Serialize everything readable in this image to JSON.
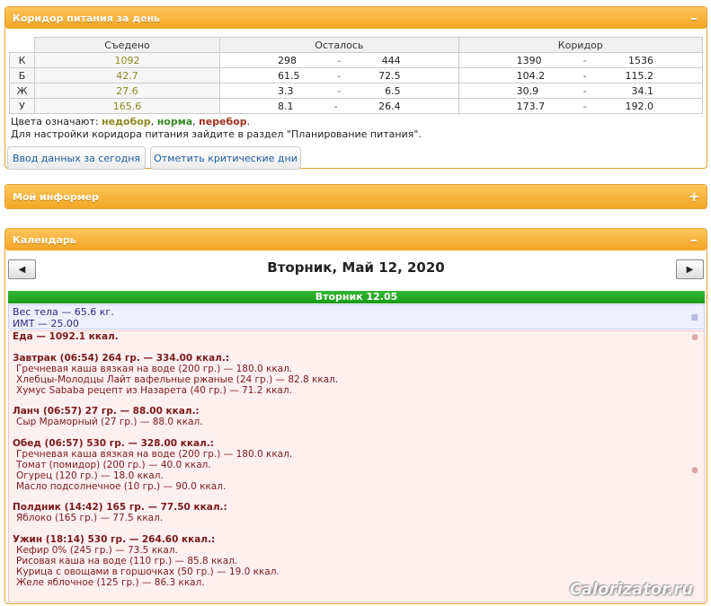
{
  "corridor_panel": {
    "title": "Коридор питания за день",
    "toggle": "–",
    "columns": {
      "eaten": "Съедено",
      "left": "Осталось",
      "corridor": "Коридор"
    },
    "rows": [
      {
        "label": "К",
        "eaten": "1092",
        "left_min": "298",
        "left_max": "444",
        "corr_min": "1390",
        "corr_max": "1536"
      },
      {
        "label": "Б",
        "eaten": "42.7",
        "left_min": "61.5",
        "left_max": "72.5",
        "corr_min": "104.2",
        "corr_max": "115.2"
      },
      {
        "label": "Ж",
        "eaten": "27.6",
        "left_min": "3.3",
        "left_max": "6.5",
        "corr_min": "30.9",
        "corr_max": "34.1"
      },
      {
        "label": "У",
        "eaten": "165.6",
        "left_min": "8.1",
        "left_max": "26.4",
        "corr_min": "173.7",
        "corr_max": "192.0"
      }
    ],
    "dash": "-",
    "legend_prefix": "Цвета означают: ",
    "legend_under": "недобор",
    "legend_norm": "норма",
    "legend_over": "перебор",
    "legend_sep": ", ",
    "legend_end": ".",
    "settings_note": "Для настройки коридора питания зайдите в раздел \"Планирование питания\".",
    "btn_enter": "Ввод данных за сегодня",
    "btn_critical": "Отметить критические дни",
    "colors": {
      "under": "#8a8a20",
      "norm": "#3a8a2a",
      "over": "#a03020"
    }
  },
  "informer_panel": {
    "title": "Мой информер",
    "toggle": "+"
  },
  "calendar_panel": {
    "title": "Календарь",
    "toggle": "–",
    "prev": "◀",
    "next": "▶",
    "date_title": "Вторник, Май 12, 2020",
    "day_header": "Вторник 12.05",
    "weight_line": "Вес тела — 65.6 кг.",
    "bmi_line": "ИМТ — 25.00",
    "food_lines": [
      {
        "text": "Еда — 1092.1 ккал.",
        "kind": "meal"
      },
      {
        "text": "",
        "kind": "gap"
      },
      {
        "text": "Завтрак (06:54) 264 гр. — 334.00 ккал.:",
        "kind": "meal"
      },
      {
        "text": "Гречневая каша вязкая на воде (200 гр.) — 180.0 ккал.",
        "kind": "item"
      },
      {
        "text": "Хлебцы-Молодцы Лайт вафельные ржаные (24 гр.) — 82.8 ккал.",
        "kind": "item"
      },
      {
        "text": "Хумус Sababa рецепт из Назарета (40 гр.) — 71.2 ккал.",
        "kind": "item"
      },
      {
        "text": "",
        "kind": "gap"
      },
      {
        "text": "Ланч (06:57) 27 гр. — 88.00 ккал.:",
        "kind": "meal"
      },
      {
        "text": "Сыр Мраморный (27 гр.) — 88.0 ккал.",
        "kind": "item"
      },
      {
        "text": "",
        "kind": "gap"
      },
      {
        "text": "Обед (06:57) 530 гр. — 328.00 ккал.:",
        "kind": "meal"
      },
      {
        "text": "Гречневая каша вязкая на воде (200 гр.) — 180.0 ккал.",
        "kind": "item"
      },
      {
        "text": "Томат (помидор) (200 гр.) — 40.0 ккал.",
        "kind": "item"
      },
      {
        "text": "Огурец (120 гр.) — 18.0 ккал.",
        "kind": "item"
      },
      {
        "text": "Масло подсолнечное (10 гр.) — 90.0 ккал.",
        "kind": "item"
      },
      {
        "text": "",
        "kind": "gap"
      },
      {
        "text": "Полдник (14:42) 165 гр. — 77.50 ккал.:",
        "kind": "meal"
      },
      {
        "text": "Яблоко (165 гр.) — 77.5 ккал.",
        "kind": "item"
      },
      {
        "text": "",
        "kind": "gap"
      },
      {
        "text": "Ужин (18:14) 530 гр. — 264.60 ккал.:",
        "kind": "meal"
      },
      {
        "text": "Кефир 0% (245 гр.) — 73.5 ккал.",
        "kind": "item"
      },
      {
        "text": "Рисовая каша на воде (110 гр.) — 85.8 ккал.",
        "kind": "item"
      },
      {
        "text": "Курица с овощами в горшочках (50 гр.) — 19.0 ккал.",
        "kind": "item"
      },
      {
        "text": "Желе яблочное (125 гр.) — 86.3 ккал.",
        "kind": "item"
      }
    ]
  },
  "watermark": "Calorizator.ru"
}
